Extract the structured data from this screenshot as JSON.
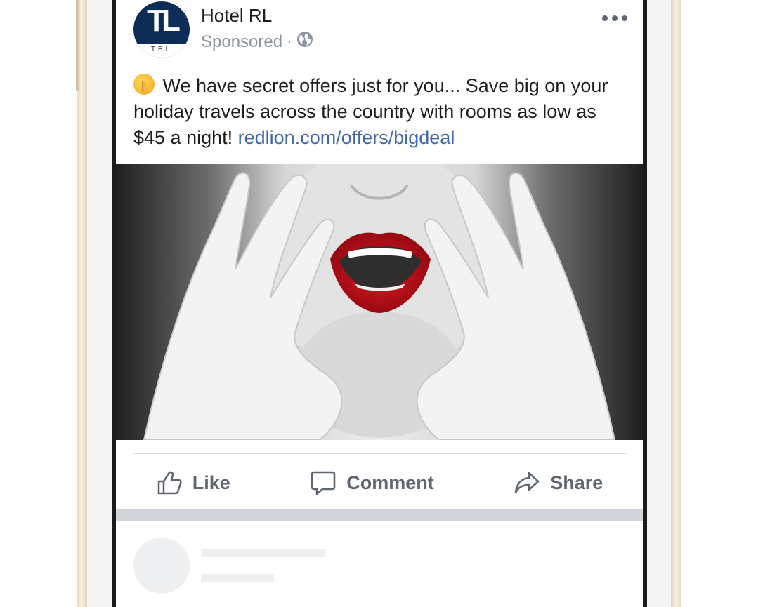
{
  "post": {
    "page_name": "Hotel RL",
    "avatar_monogram": "TL",
    "avatar_band_text": "TEL",
    "sponsored_label": "Sponsored",
    "separator": "·",
    "audience_icon": "globe-icon",
    "more_icon": "more-options-icon",
    "text": "We have secret offers just for you... Save big on your holiday travels across the country with rooms as low as $45 a night!",
    "emoji": "shushing-face-emoji",
    "link": "redlion.com/offers/bigdeal",
    "image_alt": "Black and white photo of woman with red lips and hands cupped around mouth"
  },
  "actions": {
    "like_label": "Like",
    "comment_label": "Comment",
    "share_label": "Share"
  },
  "colors": {
    "brand_navy": "#0d2d57",
    "link_blue": "#4267b2",
    "secondary_text": "#8d949e",
    "action_gray": "#606770",
    "lip_red": "#c0101a"
  }
}
